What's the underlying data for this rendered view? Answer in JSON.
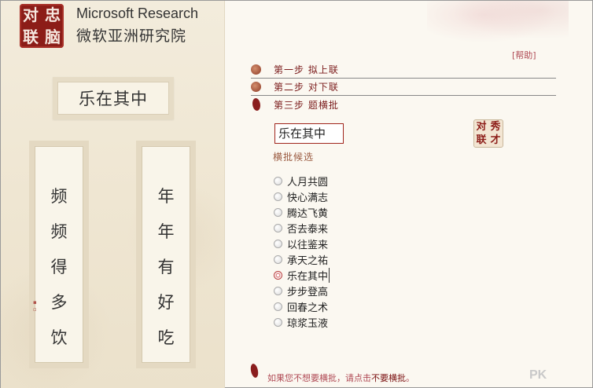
{
  "header": {
    "logo_chars": [
      "对",
      "忠",
      "联",
      "脑"
    ],
    "brand_en": "Microsoft Research",
    "brand_zh": "微软亚洲研究院"
  },
  "display": {
    "hengpi": "乐在其中",
    "upper_couplet": [
      "频",
      "频",
      "得",
      "多",
      "饮"
    ],
    "lower_couplet": [
      "年",
      "年",
      "有",
      "好",
      "吃"
    ]
  },
  "help_label": "[帮助]",
  "steps": [
    {
      "label": "第一步 拟上联"
    },
    {
      "label": "第二步 对下联"
    },
    {
      "label": "第三步 题横批"
    }
  ],
  "hengpi_input": {
    "value": "乐在其中"
  },
  "generate_button": {
    "chars": [
      "对",
      "秀",
      "联",
      "才"
    ]
  },
  "candidates_title": "横批候选",
  "candidates": [
    {
      "label": "人月共圆"
    },
    {
      "label": "快心满志"
    },
    {
      "label": "腾达飞黄"
    },
    {
      "label": "否去泰来"
    },
    {
      "label": "以往鉴来"
    },
    {
      "label": "承天之祐"
    },
    {
      "label": "乐在其中",
      "selected": true
    },
    {
      "label": "步步登高"
    },
    {
      "label": "回春之术"
    },
    {
      "label": "琼浆玉液"
    }
  ],
  "selected_index": 6,
  "footer": {
    "prefix": "如果您不想要横批，请点击",
    "link": "不要横批",
    "suffix": "。"
  },
  "watermark": "PK",
  "colors": {
    "accent_red": "#8c1d18",
    "link_pink": "#b04a55"
  }
}
